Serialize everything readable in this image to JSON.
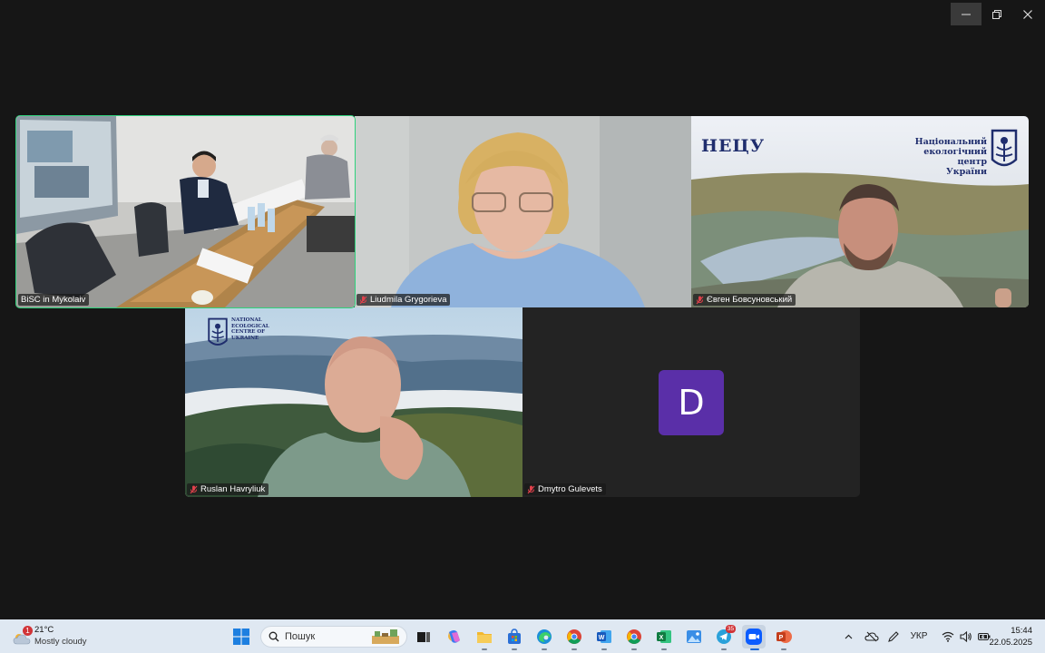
{
  "window_controls": {
    "minimize": "minimize",
    "restore": "restore",
    "close": "close"
  },
  "participants": [
    {
      "name": "BiSC in Mykolaiv",
      "muted": false,
      "active_speaker": true
    },
    {
      "name": "Liudmila Grygorieva",
      "muted": true
    },
    {
      "name": "Євген Бовсуновський",
      "muted": true,
      "background_logo_text": "НЕЦУ",
      "background_org_text": [
        "Національний",
        "екологічний",
        "центр України"
      ]
    },
    {
      "name": "Ruslan Havryliuk",
      "muted": true,
      "background_logo_text": [
        "NATIONAL",
        "ECOLOGICAL",
        "CENTRE OF",
        "UKRAINE"
      ]
    },
    {
      "name": "Dmytro Gulevets",
      "muted": true,
      "avatar_letter": "D"
    }
  ],
  "taskbar": {
    "weather": {
      "temp": "21°C",
      "condition": "Mostly cloudy",
      "badge": "1"
    },
    "search_placeholder": "Пошук",
    "apps": [
      "start-icon",
      "search",
      "task-view-icon",
      "copilot-icon",
      "file-explorer-icon",
      "store-icon",
      "edge-icon",
      "chrome-icon",
      "word-icon",
      "chrome-icon",
      "excel-icon",
      "photos-icon",
      "telegram-icon",
      "zoom-icon",
      "powerpoint-icon"
    ],
    "telegram_badge": "35",
    "tray": {
      "language": "УКР"
    },
    "clock": {
      "time": "15:44",
      "date": "22.05.2025"
    }
  }
}
